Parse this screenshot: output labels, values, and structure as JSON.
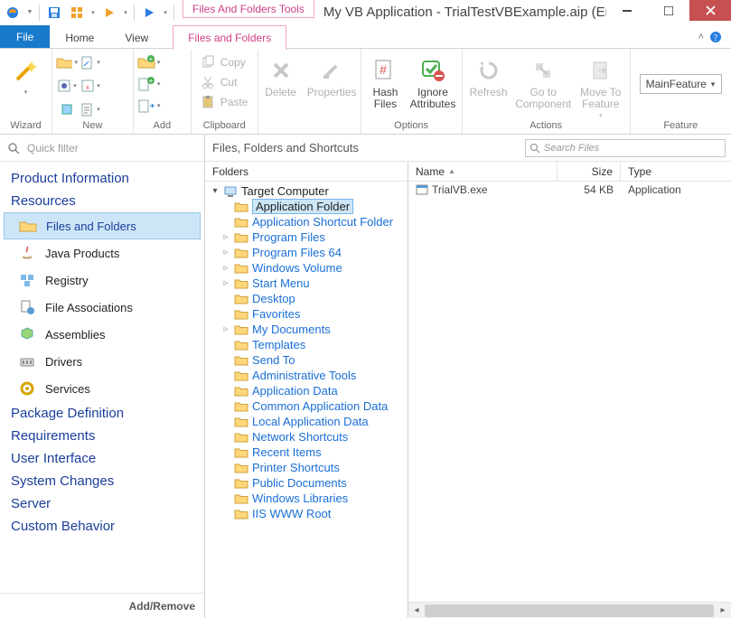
{
  "titlebar": {
    "context_tab_group": "Files And Folders Tools",
    "title": "My VB Application - TrialTestVBExample.aip (English ..."
  },
  "tabs": {
    "file": "File",
    "home": "Home",
    "view": "View",
    "active": "Files and Folders"
  },
  "ribbon": {
    "groups": {
      "wizard": "Wizard",
      "new": "New",
      "add": "Add",
      "clipboard": "Clipboard",
      "options": "Options",
      "actions": "Actions",
      "feature": "Feature"
    },
    "buttons": {
      "copy": "Copy",
      "cut": "Cut",
      "paste": "Paste",
      "delete": "Delete",
      "properties": "Properties",
      "hash": "Hash\nFiles",
      "ignore": "Ignore\nAttributes",
      "refresh": "Refresh",
      "goto": "Go to\nComponent",
      "moveto": "Move To\nFeature"
    },
    "feature_combo": "MainFeature"
  },
  "quickfilter_placeholder": "Quick filter",
  "leftnav": {
    "sections": [
      "Product Information",
      "Resources",
      "Package Definition",
      "Requirements",
      "User Interface",
      "System Changes",
      "Server",
      "Custom Behavior"
    ],
    "resources_items": [
      "Files and Folders",
      "Java Products",
      "Registry",
      "File Associations",
      "Assemblies",
      "Drivers",
      "Services"
    ],
    "addremove": "Add/Remove"
  },
  "rightpane": {
    "title": "Files, Folders and Shortcuts",
    "search_placeholder": "Search Files",
    "folders_header": "Folders",
    "columns": {
      "name": "Name",
      "size": "Size",
      "type": "Type"
    },
    "tree": {
      "root": "Target Computer",
      "nodes": [
        {
          "label": "Application Folder",
          "selected": true
        },
        {
          "label": "Application Shortcut Folder"
        },
        {
          "label": "Program Files",
          "expandable": true
        },
        {
          "label": "Program Files 64",
          "expandable": true
        },
        {
          "label": "Windows Volume",
          "expandable": true
        },
        {
          "label": "Start Menu",
          "expandable": true
        },
        {
          "label": "Desktop"
        },
        {
          "label": "Favorites"
        },
        {
          "label": "My Documents",
          "expandable": true
        },
        {
          "label": "Templates"
        },
        {
          "label": "Send To"
        },
        {
          "label": "Administrative Tools"
        },
        {
          "label": "Application Data"
        },
        {
          "label": "Common Application Data"
        },
        {
          "label": "Local Application Data"
        },
        {
          "label": "Network Shortcuts"
        },
        {
          "label": "Recent Items"
        },
        {
          "label": "Printer Shortcuts"
        },
        {
          "label": "Public Documents"
        },
        {
          "label": "Windows Libraries"
        },
        {
          "label": "IIS WWW Root"
        }
      ]
    },
    "files": [
      {
        "name": "TrialVB.exe",
        "size": "54 KB",
        "type": "Application"
      }
    ]
  }
}
